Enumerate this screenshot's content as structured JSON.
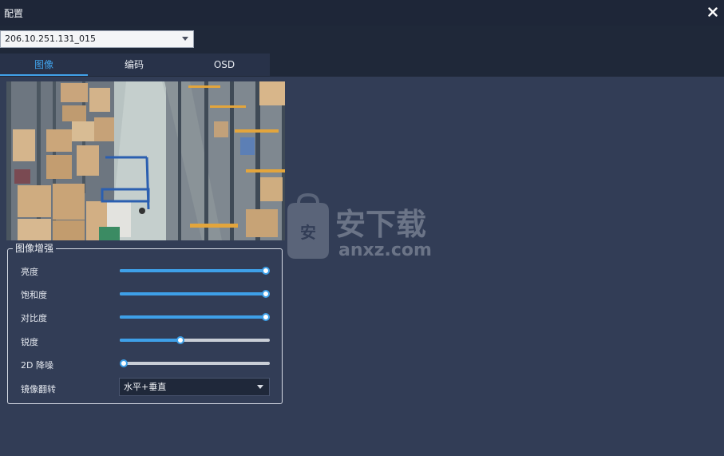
{
  "window": {
    "title": "配置"
  },
  "device": {
    "selected": "206.10.251.131_015"
  },
  "tabs": [
    {
      "label": "图像",
      "active": true
    },
    {
      "label": "编码",
      "active": false
    },
    {
      "label": "OSD",
      "active": false
    }
  ],
  "image_enhance": {
    "title": "图像增强",
    "sliders": [
      {
        "label": "亮度",
        "value": 1.0
      },
      {
        "label": "饱和度",
        "value": 1.0
      },
      {
        "label": "对比度",
        "value": 1.0
      },
      {
        "label": "锐度",
        "value": 0.4
      },
      {
        "label": "2D 降噪",
        "value": 0.0
      }
    ],
    "mirror": {
      "label": "镜像翻转",
      "selected": "水平+垂直"
    }
  },
  "watermark": {
    "text": "安下载",
    "sub": "anxz.com"
  },
  "colors": {
    "accent": "#3ea0e8",
    "background": "#323d56",
    "titlebar": "#1e2638"
  }
}
